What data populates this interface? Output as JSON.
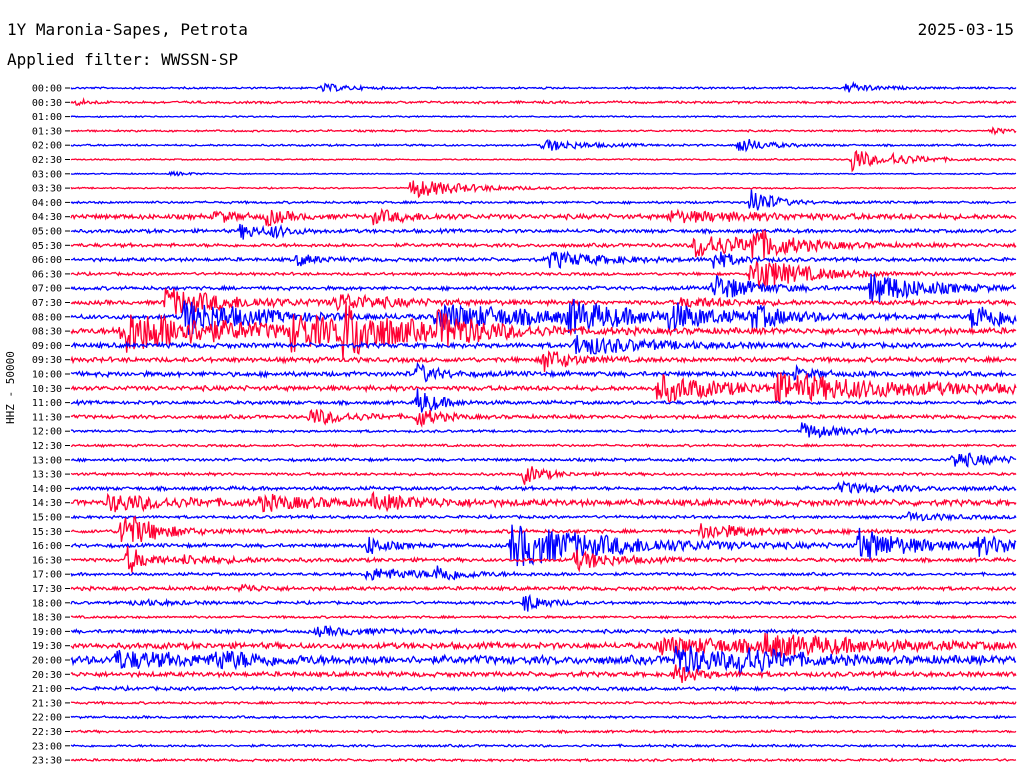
{
  "header": {
    "station": "1Y Maronia-Sapes, Petrota",
    "date": "2025-03-15",
    "filter": "Applied filter: WWSSN-SP"
  },
  "chart_data": {
    "type": "line",
    "title": "1Y Maronia-Sapes, Petrota",
    "ylabel": "HHZ - 50000",
    "xlim": [
      0,
      15
    ],
    "row_labels": [
      "00:00",
      "00:30",
      "01:00",
      "01:30",
      "02:00",
      "02:30",
      "03:00",
      "03:30",
      "04:00",
      "04:30",
      "05:00",
      "05:30",
      "06:00",
      "06:30",
      "07:00",
      "07:30",
      "08:00",
      "08:30",
      "09:00",
      "09:30",
      "10:00",
      "10:30",
      "11:00",
      "11:30",
      "12:00",
      "12:30",
      "13:00",
      "13:30",
      "14:00",
      "14:30",
      "15:00",
      "15:30",
      "16:00",
      "16:30",
      "17:00",
      "17:30",
      "18:00",
      "18:30",
      "19:00",
      "19:30",
      "20:00",
      "20:30",
      "21:00",
      "21:30",
      "22:00",
      "22:30",
      "23:00",
      "23:30"
    ],
    "colors": [
      "#0000ff",
      "#ff0033"
    ],
    "noise": [
      0.8,
      1.0,
      0.6,
      0.8,
      0.8,
      0.6,
      0.5,
      0.6,
      1.0,
      2.0,
      1.5,
      1.5,
      1.5,
      1.2,
      1.5,
      1.8,
      2.0,
      2.5,
      2.0,
      2.0,
      2.0,
      2.0,
      1.5,
      1.5,
      1.0,
      1.0,
      1.2,
      1.2,
      1.5,
      2.5,
      1.2,
      1.5,
      1.5,
      1.5,
      1.2,
      1.5,
      1.2,
      1.0,
      1.5,
      2.5,
      3.5,
      2.0,
      1.5,
      1.0,
      1.0,
      1.0,
      1.0,
      1.0
    ],
    "events": [
      {
        "row": 0,
        "t": 4.0,
        "a": 4,
        "d": 0.4
      },
      {
        "row": 0,
        "t": 12.3,
        "a": 5,
        "d": 0.4
      },
      {
        "row": 1,
        "t": 0.1,
        "a": 3,
        "d": 0.2
      },
      {
        "row": 3,
        "t": 14.6,
        "a": 3,
        "d": 0.3
      },
      {
        "row": 4,
        "t": 7.5,
        "a": 6,
        "d": 0.6
      },
      {
        "row": 4,
        "t": 10.6,
        "a": 8,
        "d": 0.4
      },
      {
        "row": 5,
        "t": 12.4,
        "a": 14,
        "d": 0.3
      },
      {
        "row": 5,
        "t": 13.0,
        "a": 5,
        "d": 0.6
      },
      {
        "row": 6,
        "t": 1.6,
        "a": 2,
        "d": 0.3
      },
      {
        "row": 7,
        "t": 5.4,
        "a": 10,
        "d": 0.8
      },
      {
        "row": 8,
        "t": 10.8,
        "a": 16,
        "d": 0.3
      },
      {
        "row": 9,
        "t": 2.3,
        "a": 6,
        "d": 0.3
      },
      {
        "row": 9,
        "t": 3.1,
        "a": 8,
        "d": 0.3
      },
      {
        "row": 9,
        "t": 4.8,
        "a": 6,
        "d": 0.6
      },
      {
        "row": 9,
        "t": 9.5,
        "a": 5,
        "d": 1.5
      },
      {
        "row": 10,
        "t": 2.7,
        "a": 8,
        "d": 0.3
      },
      {
        "row": 10,
        "t": 3.2,
        "a": 5,
        "d": 0.3
      },
      {
        "row": 11,
        "t": 9.9,
        "a": 12,
        "d": 1.0
      },
      {
        "row": 11,
        "t": 10.8,
        "a": 14,
        "d": 0.5
      },
      {
        "row": 12,
        "t": 3.6,
        "a": 6,
        "d": 0.3
      },
      {
        "row": 12,
        "t": 7.6,
        "a": 8,
        "d": 0.8
      },
      {
        "row": 12,
        "t": 10.2,
        "a": 10,
        "d": 0.3
      },
      {
        "row": 13,
        "t": 10.8,
        "a": 18,
        "d": 0.8
      },
      {
        "row": 14,
        "t": 10.2,
        "a": 14,
        "d": 0.6
      },
      {
        "row": 14,
        "t": 12.7,
        "a": 16,
        "d": 0.8
      },
      {
        "row": 15,
        "t": 1.5,
        "a": 14,
        "d": 1.0
      },
      {
        "row": 15,
        "t": 4.2,
        "a": 8,
        "d": 0.8
      },
      {
        "row": 15,
        "t": 9.7,
        "a": 5,
        "d": 0.8
      },
      {
        "row": 16,
        "t": 1.8,
        "a": 18,
        "d": 1.0
      },
      {
        "row": 16,
        "t": 5.8,
        "a": 14,
        "d": 1.6
      },
      {
        "row": 16,
        "t": 7.9,
        "a": 14,
        "d": 0.8
      },
      {
        "row": 16,
        "t": 9.5,
        "a": 12,
        "d": 0.6
      },
      {
        "row": 16,
        "t": 10.8,
        "a": 10,
        "d": 0.6
      },
      {
        "row": 16,
        "t": 14.3,
        "a": 12,
        "d": 1.0
      },
      {
        "row": 17,
        "t": 0.8,
        "a": 22,
        "d": 1.6
      },
      {
        "row": 17,
        "t": 3.5,
        "a": 16,
        "d": 0.8
      },
      {
        "row": 17,
        "t": 4.3,
        "a": 24,
        "d": 0.8
      },
      {
        "row": 17,
        "t": 5.8,
        "a": 14,
        "d": 0.8
      },
      {
        "row": 18,
        "t": 8.0,
        "a": 10,
        "d": 1.0
      },
      {
        "row": 19,
        "t": 7.5,
        "a": 12,
        "d": 0.4
      },
      {
        "row": 20,
        "t": 5.5,
        "a": 10,
        "d": 0.3
      },
      {
        "row": 20,
        "t": 11.5,
        "a": 6,
        "d": 0.3
      },
      {
        "row": 21,
        "t": 9.3,
        "a": 14,
        "d": 1.0
      },
      {
        "row": 21,
        "t": 11.2,
        "a": 12,
        "d": 2.5
      },
      {
        "row": 22,
        "t": 5.5,
        "a": 14,
        "d": 0.3
      },
      {
        "row": 23,
        "t": 3.8,
        "a": 8,
        "d": 0.6
      },
      {
        "row": 23,
        "t": 5.5,
        "a": 10,
        "d": 0.3
      },
      {
        "row": 24,
        "t": 11.6,
        "a": 8,
        "d": 0.6
      },
      {
        "row": 26,
        "t": 14.0,
        "a": 8,
        "d": 0.6
      },
      {
        "row": 27,
        "t": 7.2,
        "a": 10,
        "d": 0.3
      },
      {
        "row": 28,
        "t": 12.2,
        "a": 5,
        "d": 0.8
      },
      {
        "row": 29,
        "t": 0.6,
        "a": 8,
        "d": 1.0
      },
      {
        "row": 29,
        "t": 3.0,
        "a": 6,
        "d": 1.0
      },
      {
        "row": 29,
        "t": 4.8,
        "a": 6,
        "d": 0.8
      },
      {
        "row": 30,
        "t": 13.3,
        "a": 4,
        "d": 0.6
      },
      {
        "row": 31,
        "t": 0.8,
        "a": 20,
        "d": 0.5
      },
      {
        "row": 31,
        "t": 10.0,
        "a": 8,
        "d": 0.8
      },
      {
        "row": 32,
        "t": 7.0,
        "a": 22,
        "d": 1.6
      },
      {
        "row": 32,
        "t": 4.7,
        "a": 10,
        "d": 0.3
      },
      {
        "row": 32,
        "t": 12.5,
        "a": 16,
        "d": 0.8
      },
      {
        "row": 32,
        "t": 14.4,
        "a": 8,
        "d": 1.0
      },
      {
        "row": 33,
        "t": 0.9,
        "a": 14,
        "d": 0.3
      },
      {
        "row": 33,
        "t": 1.8,
        "a": 4,
        "d": 0.8
      },
      {
        "row": 33,
        "t": 8.0,
        "a": 10,
        "d": 0.6
      },
      {
        "row": 34,
        "t": 4.7,
        "a": 6,
        "d": 1.0
      },
      {
        "row": 34,
        "t": 5.8,
        "a": 8,
        "d": 0.3
      },
      {
        "row": 35,
        "t": 2.7,
        "a": 4,
        "d": 0.3
      },
      {
        "row": 36,
        "t": 1.0,
        "a": 3,
        "d": 0.6
      },
      {
        "row": 36,
        "t": 7.2,
        "a": 10,
        "d": 0.3
      },
      {
        "row": 38,
        "t": 3.9,
        "a": 4,
        "d": 0.8
      },
      {
        "row": 39,
        "t": 9.3,
        "a": 8,
        "d": 2.0
      },
      {
        "row": 39,
        "t": 11.0,
        "a": 8,
        "d": 1.5
      },
      {
        "row": 40,
        "t": 0.7,
        "a": 8,
        "d": 1.0
      },
      {
        "row": 40,
        "t": 2.3,
        "a": 8,
        "d": 0.6
      },
      {
        "row": 40,
        "t": 9.6,
        "a": 14,
        "d": 0.8
      },
      {
        "row": 40,
        "t": 10.6,
        "a": 12,
        "d": 0.6
      },
      {
        "row": 41,
        "t": 9.6,
        "a": 10,
        "d": 0.3
      }
    ]
  }
}
